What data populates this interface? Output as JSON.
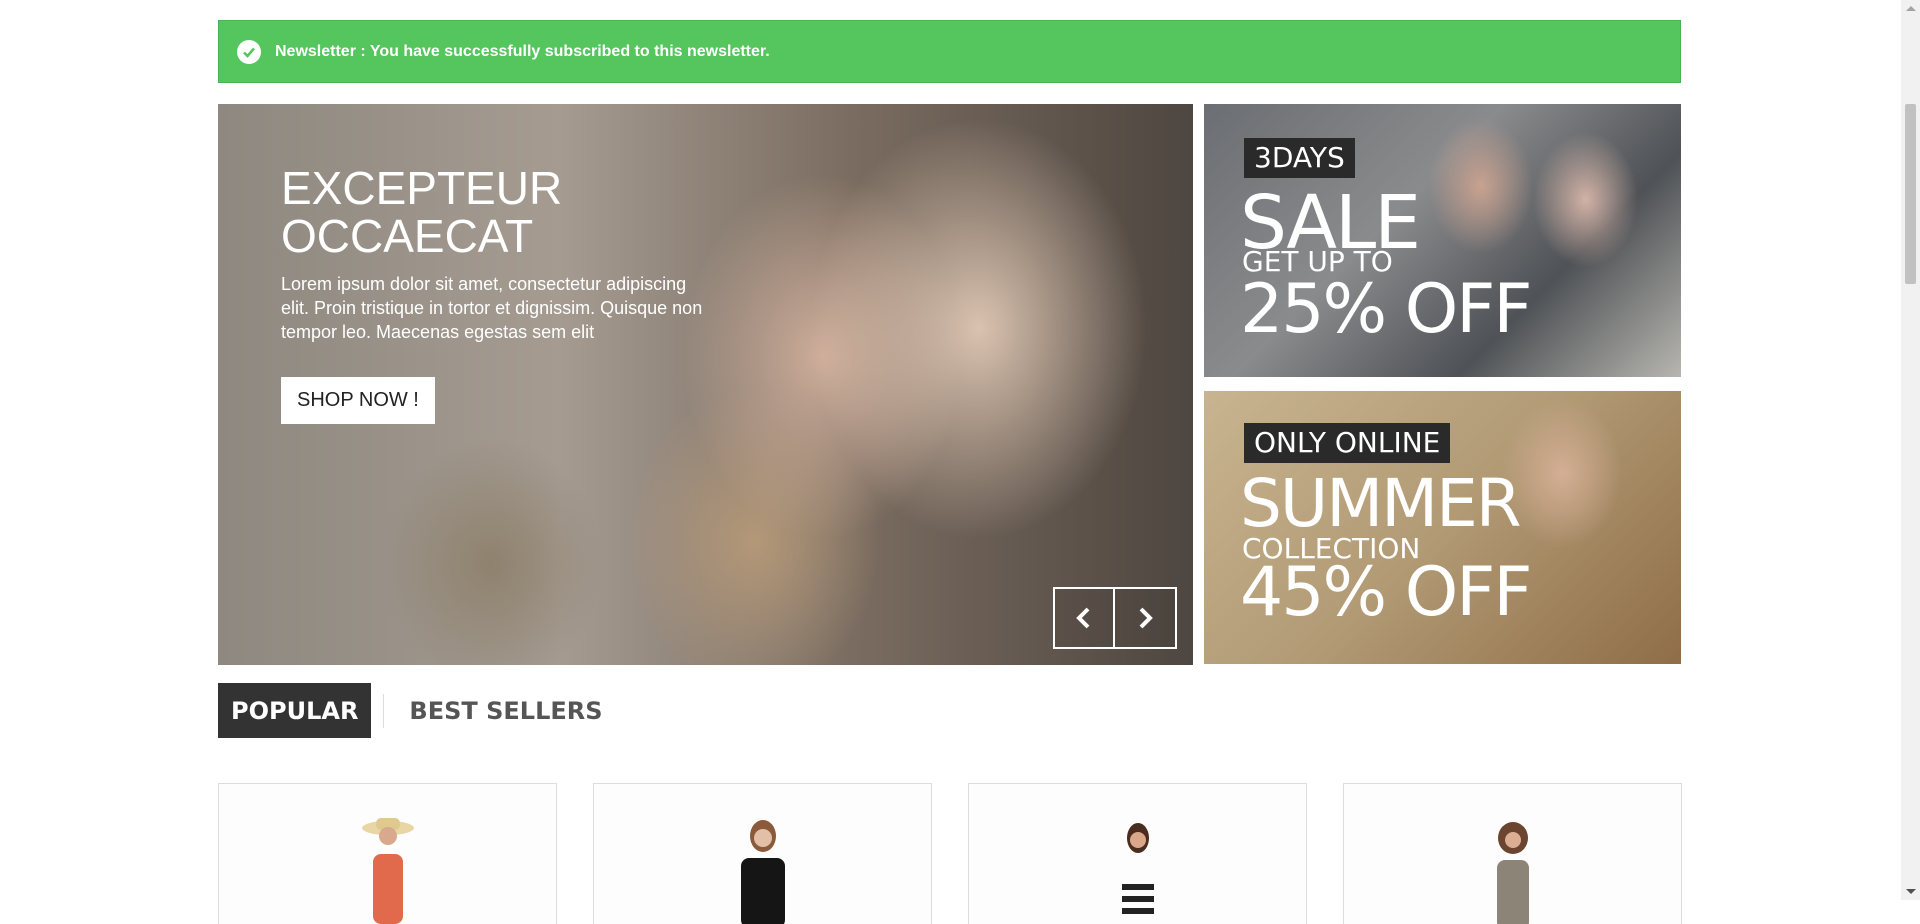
{
  "alert": {
    "text": "Newsletter : You have successfully subscribed to this newsletter.",
    "color": "#55c65e"
  },
  "slider": {
    "title": "EXCEPTEUR OCCAECAT",
    "text": "Lorem ipsum dolor sit amet, consectetur adipiscing elit. Proin tristique in tortor et dignissim. Quisque non tempor leo. Maecenas egestas sem elit",
    "button": "SHOP NOW !",
    "prev_icon": "chevron-left-icon",
    "next_icon": "chevron-right-icon"
  },
  "banners": [
    {
      "label": "3DAYS",
      "big": "SALE",
      "mid": "GET UP TO",
      "offer": "25% OFF"
    },
    {
      "label": "ONLY ONLINE",
      "big": "SUMMER",
      "mid": "COLLECTION",
      "offer": "45% OFF"
    }
  ],
  "tabs": [
    {
      "label": "POPULAR",
      "active": true
    },
    {
      "label": "BEST SELLERS",
      "active": false
    }
  ],
  "products": [
    {
      "image": "woman-in-sun-hat-and-orange-top"
    },
    {
      "image": "woman-in-black-top"
    },
    {
      "image": "woman-in-striped-dress"
    },
    {
      "image": "woman-in-printed-dress"
    }
  ]
}
